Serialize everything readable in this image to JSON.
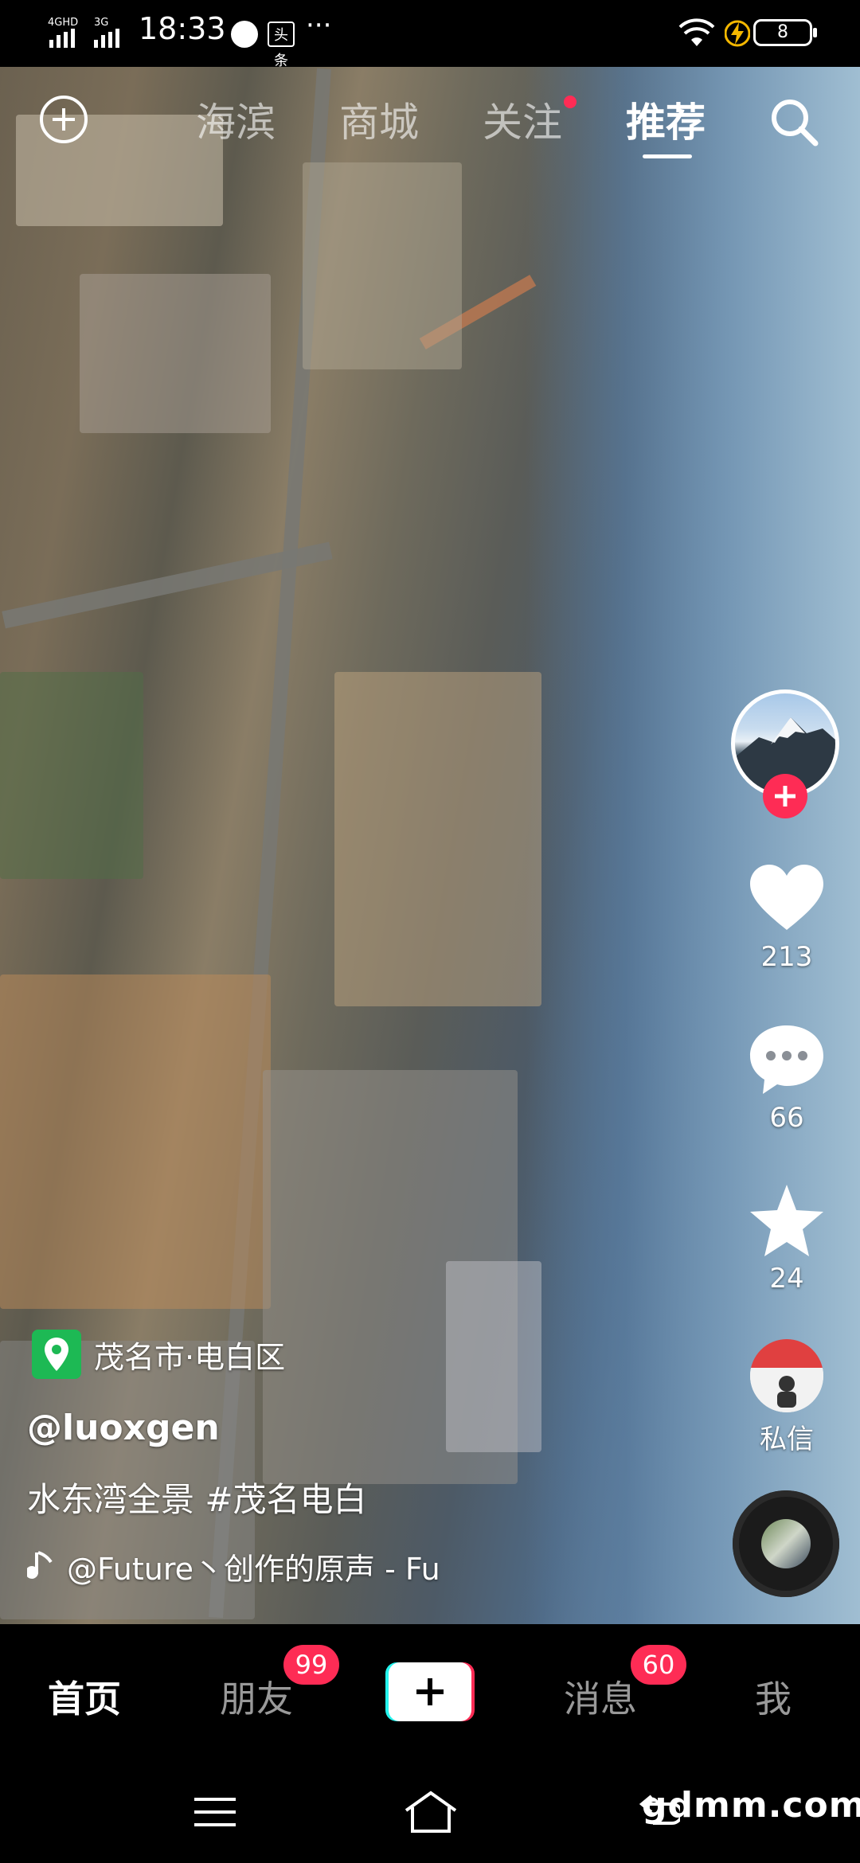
{
  "status_bar": {
    "network": "4GHD 3G",
    "time": "18:33",
    "news_icon_label": "头条",
    "more": "···",
    "battery": "8"
  },
  "top_nav": {
    "tabs": [
      {
        "label": "海滨",
        "active": false
      },
      {
        "label": "商城",
        "active": false
      },
      {
        "label": "关注",
        "active": false,
        "has_dot": true
      },
      {
        "label": "推荐",
        "active": true
      }
    ]
  },
  "rail": {
    "likes": "213",
    "comments": "66",
    "favorites": "24",
    "dm_label": "私信"
  },
  "video_info": {
    "location": "茂名市·电白区",
    "author": "@luoxgen",
    "description": "水东湾全景 #茂名电白",
    "music": "@Future丶创作的原声 - Fu"
  },
  "bottom_bar": {
    "tabs": [
      {
        "label": "首页",
        "active": true
      },
      {
        "label": "朋友",
        "badge": "99"
      },
      {
        "label": "消息",
        "badge": "60"
      },
      {
        "label": "我"
      }
    ]
  },
  "watermark": "gdmm.com",
  "colors": {
    "accent": "#fe2c55",
    "cyan": "#25f4ee",
    "location_green": "#1db954"
  }
}
